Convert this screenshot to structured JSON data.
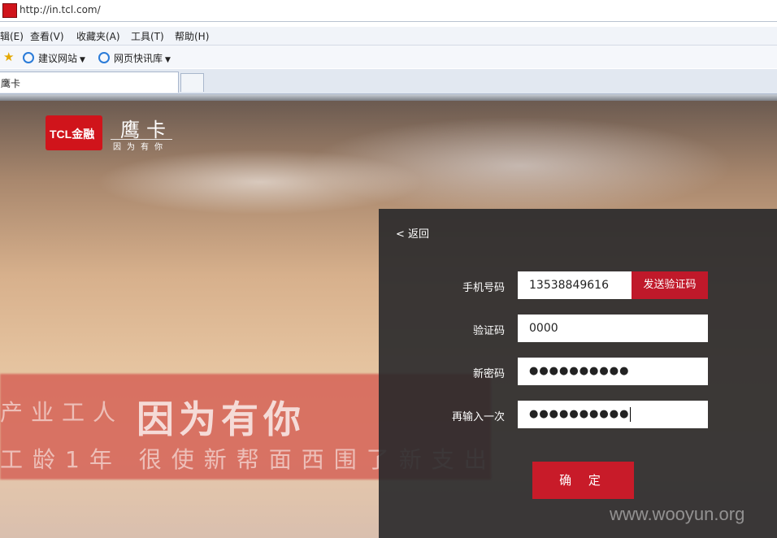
{
  "browser": {
    "url": "http://in.tcl.com/",
    "menus": [
      "辑(E)",
      "查看(V)",
      "收藏夹(A)",
      "工具(T)",
      "帮助(H)"
    ],
    "favorites": [
      "建议网站",
      "网页快讯库"
    ],
    "tab_title": "鹰卡"
  },
  "brand": {
    "logo_text": "TCL金融",
    "product_name": "鹰卡",
    "slogan": "因为有你"
  },
  "banner": {
    "headline": "因为有你",
    "line1": "产业工人",
    "line2": "工龄1年  很使新帮面西围了新支出"
  },
  "form": {
    "back_label": "< 返回",
    "phone_label": "手机号码",
    "phone_value": "13538849616",
    "send_code_label": "发送验证码",
    "code_label": "验证码",
    "code_value": "0000",
    "new_password_label": "新密码",
    "new_password_value": "●●●●●●●●●●",
    "repeat_password_label": "再输入一次",
    "repeat_password_value": "●●●●●●●●●●",
    "confirm_label": "确 定"
  },
  "watermark": "www.wooyun.org",
  "colors": {
    "brand_red": "#c81b29",
    "panel_bg": "#28282a"
  }
}
